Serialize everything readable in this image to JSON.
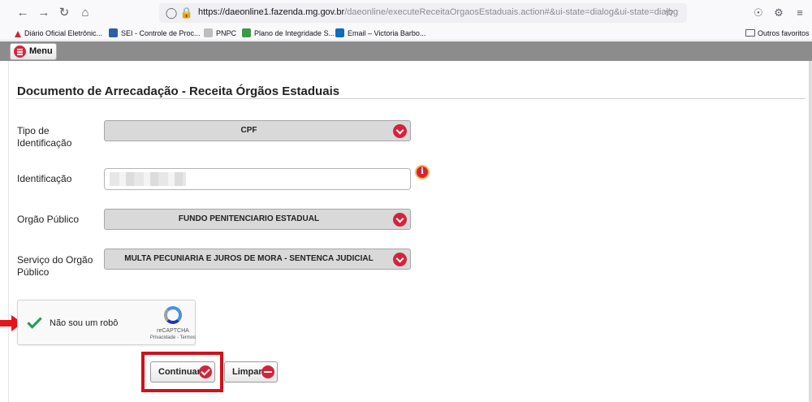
{
  "browser": {
    "url_host": "https://daeonline1.fazenda.mg.gov.br",
    "url_path": "/daeonline/executeReceitaOrgaosEstaduais.action#&ui-state=dialog&ui-state=dialog",
    "bookmarks": [
      {
        "label": "Diário Oficial Eletrônic...",
        "icon": "diario-icon",
        "color": "#d6223b"
      },
      {
        "label": "SEI - Controle de Proc...",
        "icon": "sei-icon",
        "color": "#2b5ea7"
      },
      {
        "label": "PNPC",
        "icon": "pnpc-icon",
        "color": "#9a9a9a"
      },
      {
        "label": "Plano de Integridade S...",
        "icon": "plano-icon",
        "color": "#3a9a45"
      },
      {
        "label": "Email – Victoria Barbo...",
        "icon": "outlook-icon",
        "color": "#0f6cbd"
      }
    ],
    "other_favorites": "Outros favoritos"
  },
  "app": {
    "menu_label": "Menu",
    "page_title": "Documento de Arrecadação - Receita Órgãos Estaduais"
  },
  "form": {
    "tipo_label": "Tipo de Identificação",
    "tipo_value": "CPF",
    "identificacao_label": "Identificação",
    "orgao_label": "Orgão Público",
    "orgao_value": "FUNDO PENITENCIARIO ESTADUAL",
    "servico_label": "Serviço do Orgão Público",
    "servico_value": "MULTA PECUNIARIA E JUROS DE MORA - SENTENCA JUDICIAL"
  },
  "recaptcha": {
    "checked": true,
    "label": "Não sou um robô",
    "brand": "reCAPTCHA",
    "links": "Privacidade - Termos"
  },
  "buttons": {
    "continuar": "Continuar",
    "limpar": "Limpar"
  },
  "colors": {
    "accent_red": "#d6223b",
    "highlight_red": "#d0121b",
    "app_bar_gray": "#8c8c8c"
  }
}
